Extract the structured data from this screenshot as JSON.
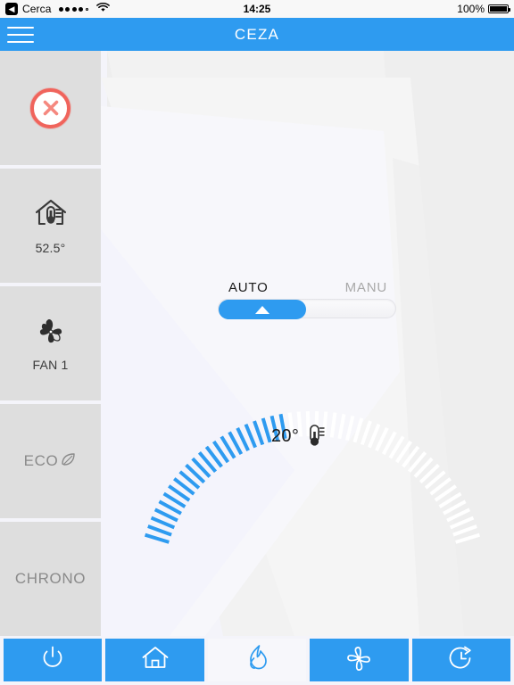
{
  "status_bar": {
    "back_glyph": "◀",
    "carrier": "Cerca",
    "signal_dots_filled": 4,
    "signal_dots_total": 5,
    "wifi_icon": "wifi-icon",
    "time": "14:25",
    "battery_percent": "100%",
    "battery_level": 100
  },
  "navbar": {
    "menu_icon": "hamburger-menu-icon",
    "title": "CEZA"
  },
  "sidebar": {
    "items": [
      {
        "key": "power-state",
        "icon": "circle-x-icon",
        "label": "",
        "active": false
      },
      {
        "key": "home-temp",
        "icon": "house-thermometer-icon",
        "label": "52.5°",
        "active": true
      },
      {
        "key": "fan-speed",
        "icon": "fan-icon",
        "label": "FAN 1",
        "active": true
      },
      {
        "key": "eco-mode",
        "icon": "leaf-icon",
        "label": "ECO",
        "active": false
      },
      {
        "key": "chrono-mode",
        "icon": "",
        "label": "CHRONO",
        "active": false
      }
    ]
  },
  "mode_switch": {
    "auto_label": "AUTO",
    "manu_label": "MANU",
    "selected": "AUTO",
    "knob_icon": "up-triangle-icon"
  },
  "dial": {
    "value_label": "20°",
    "thermometer_icon": "thermometer-icon",
    "ticks_total": 50,
    "ticks_filled": 22,
    "filled_color": "#2e9bf0",
    "empty_color": "#ffffff"
  },
  "tabbar": {
    "tabs": [
      {
        "key": "power",
        "icon": "power-icon",
        "active": false
      },
      {
        "key": "home",
        "icon": "home-icon",
        "active": false
      },
      {
        "key": "flame",
        "icon": "flame-icon",
        "active": true
      },
      {
        "key": "fan",
        "icon": "fan-icon",
        "active": false
      },
      {
        "key": "timer",
        "icon": "timer-icon",
        "active": false
      }
    ]
  },
  "colors": {
    "accent_blue": "#2e9bf0",
    "sidebar_grey": "#dedede",
    "alert_red": "#f0645c",
    "page_bg": "#f4f4fa"
  }
}
